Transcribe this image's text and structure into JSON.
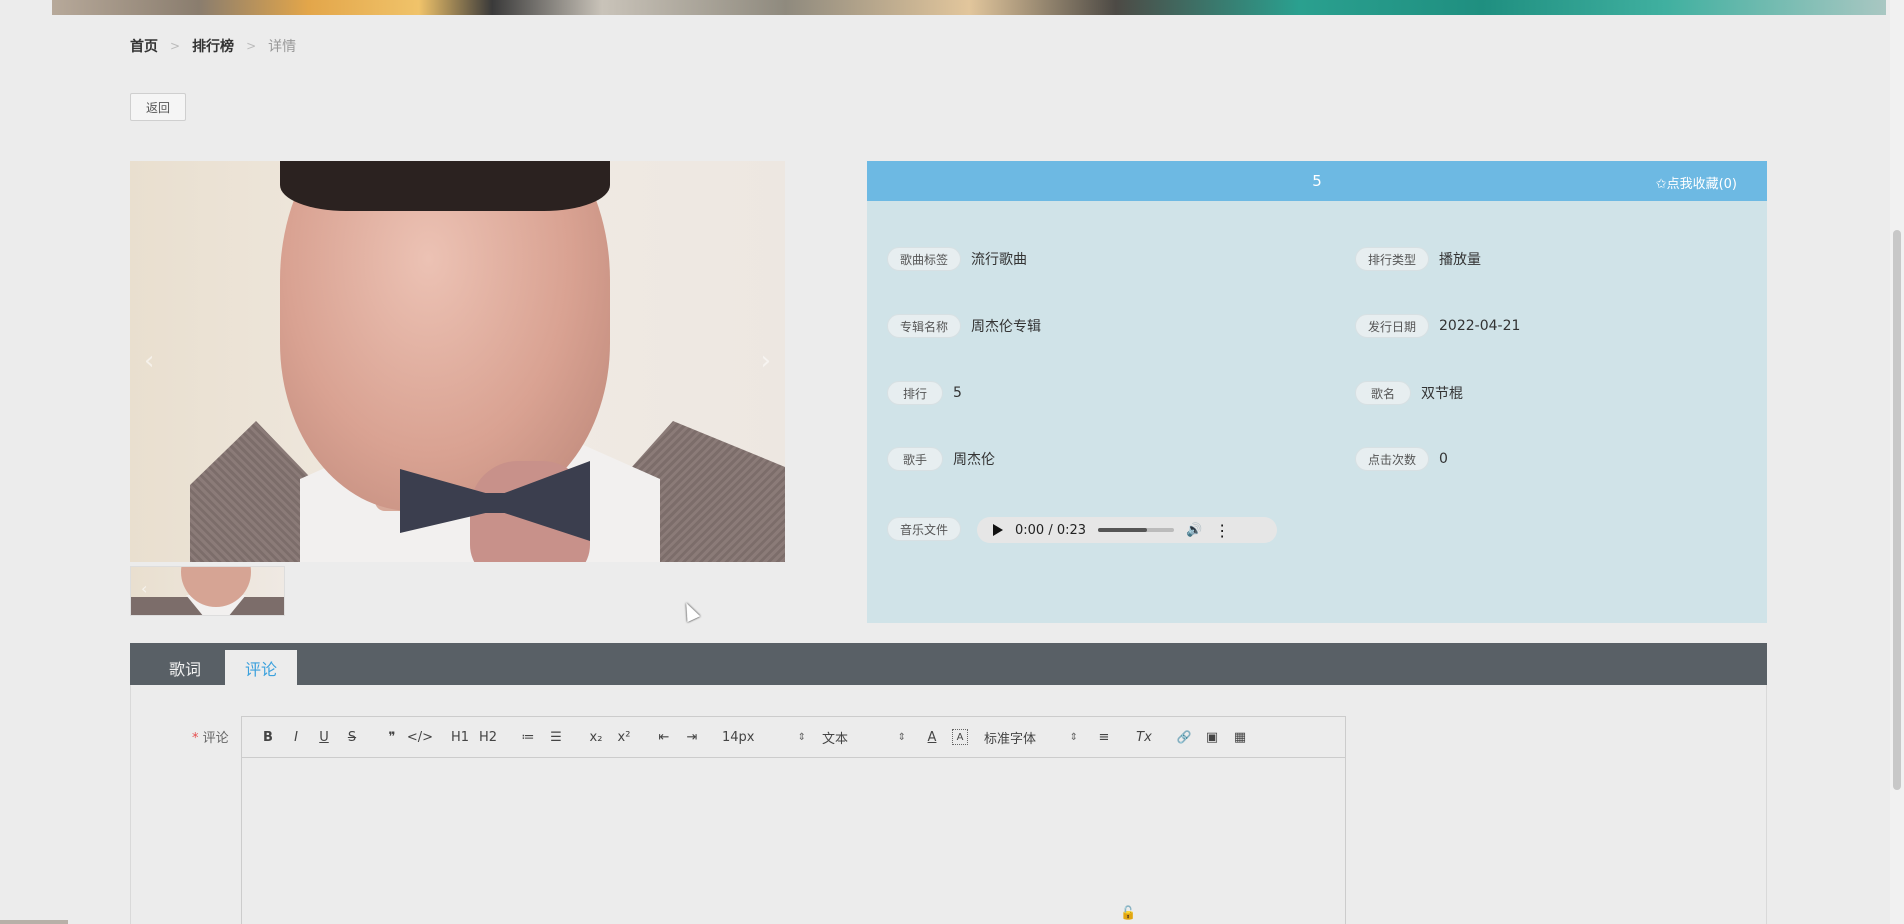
{
  "breadcrumb": {
    "home": "首页",
    "ranking": "排行榜",
    "current": "详情",
    "separator": ">"
  },
  "back_button": "返回",
  "gallery": {
    "prev_icon": "‹",
    "next_icon": "›",
    "thumb_prev_icon": "‹"
  },
  "info": {
    "title": "5",
    "favorite": "✩点我收藏(0)",
    "fields": [
      {
        "label": "歌曲标签",
        "value": "流行歌曲"
      },
      {
        "label": "排行类型",
        "value": "播放量"
      },
      {
        "label": "专辑名称",
        "value": "周杰伦专辑"
      },
      {
        "label": "发行日期",
        "value": "2022-04-21"
      },
      {
        "label": "排行",
        "value": "5"
      },
      {
        "label": "歌名",
        "value": "双节棍"
      },
      {
        "label": "歌手",
        "value": "周杰伦"
      },
      {
        "label": "点击次数",
        "value": "0"
      }
    ],
    "audio": {
      "label": "音乐文件",
      "time": "0:00 / 0:23",
      "volume_level": 0.65
    }
  },
  "tabs": {
    "lyrics": "歌词",
    "comments": "评论",
    "active": "评论"
  },
  "comment": {
    "label": "评论",
    "required_mark": "*"
  },
  "toolbar": {
    "bold": "B",
    "italic": "I",
    "underline": "U",
    "strike": "S",
    "quote": "❞",
    "code": "</>",
    "h1": "H1",
    "h2": "H2",
    "ordered_list": "≔",
    "bullet_list": "☰",
    "subscript": "x₂",
    "superscript": "x²",
    "outdent": "⇤",
    "indent": "⇥",
    "size": "14px",
    "header_style": "文本",
    "text_color": "A",
    "background_color": "A",
    "font": "标准字体",
    "align": "≡",
    "clear_format": "Tx",
    "link": "🔗",
    "image": "▣",
    "video": "▦"
  },
  "icons": {
    "lock": "🔓",
    "chevron": "⇕",
    "play": "play-icon",
    "volume": "🔊",
    "more": "⋮"
  },
  "colors": {
    "header_blue": "#6db9e3",
    "panel_bg": "#d0e3e8",
    "tab_bar": "#596066",
    "active_tab_text": "#3ba1dd"
  }
}
